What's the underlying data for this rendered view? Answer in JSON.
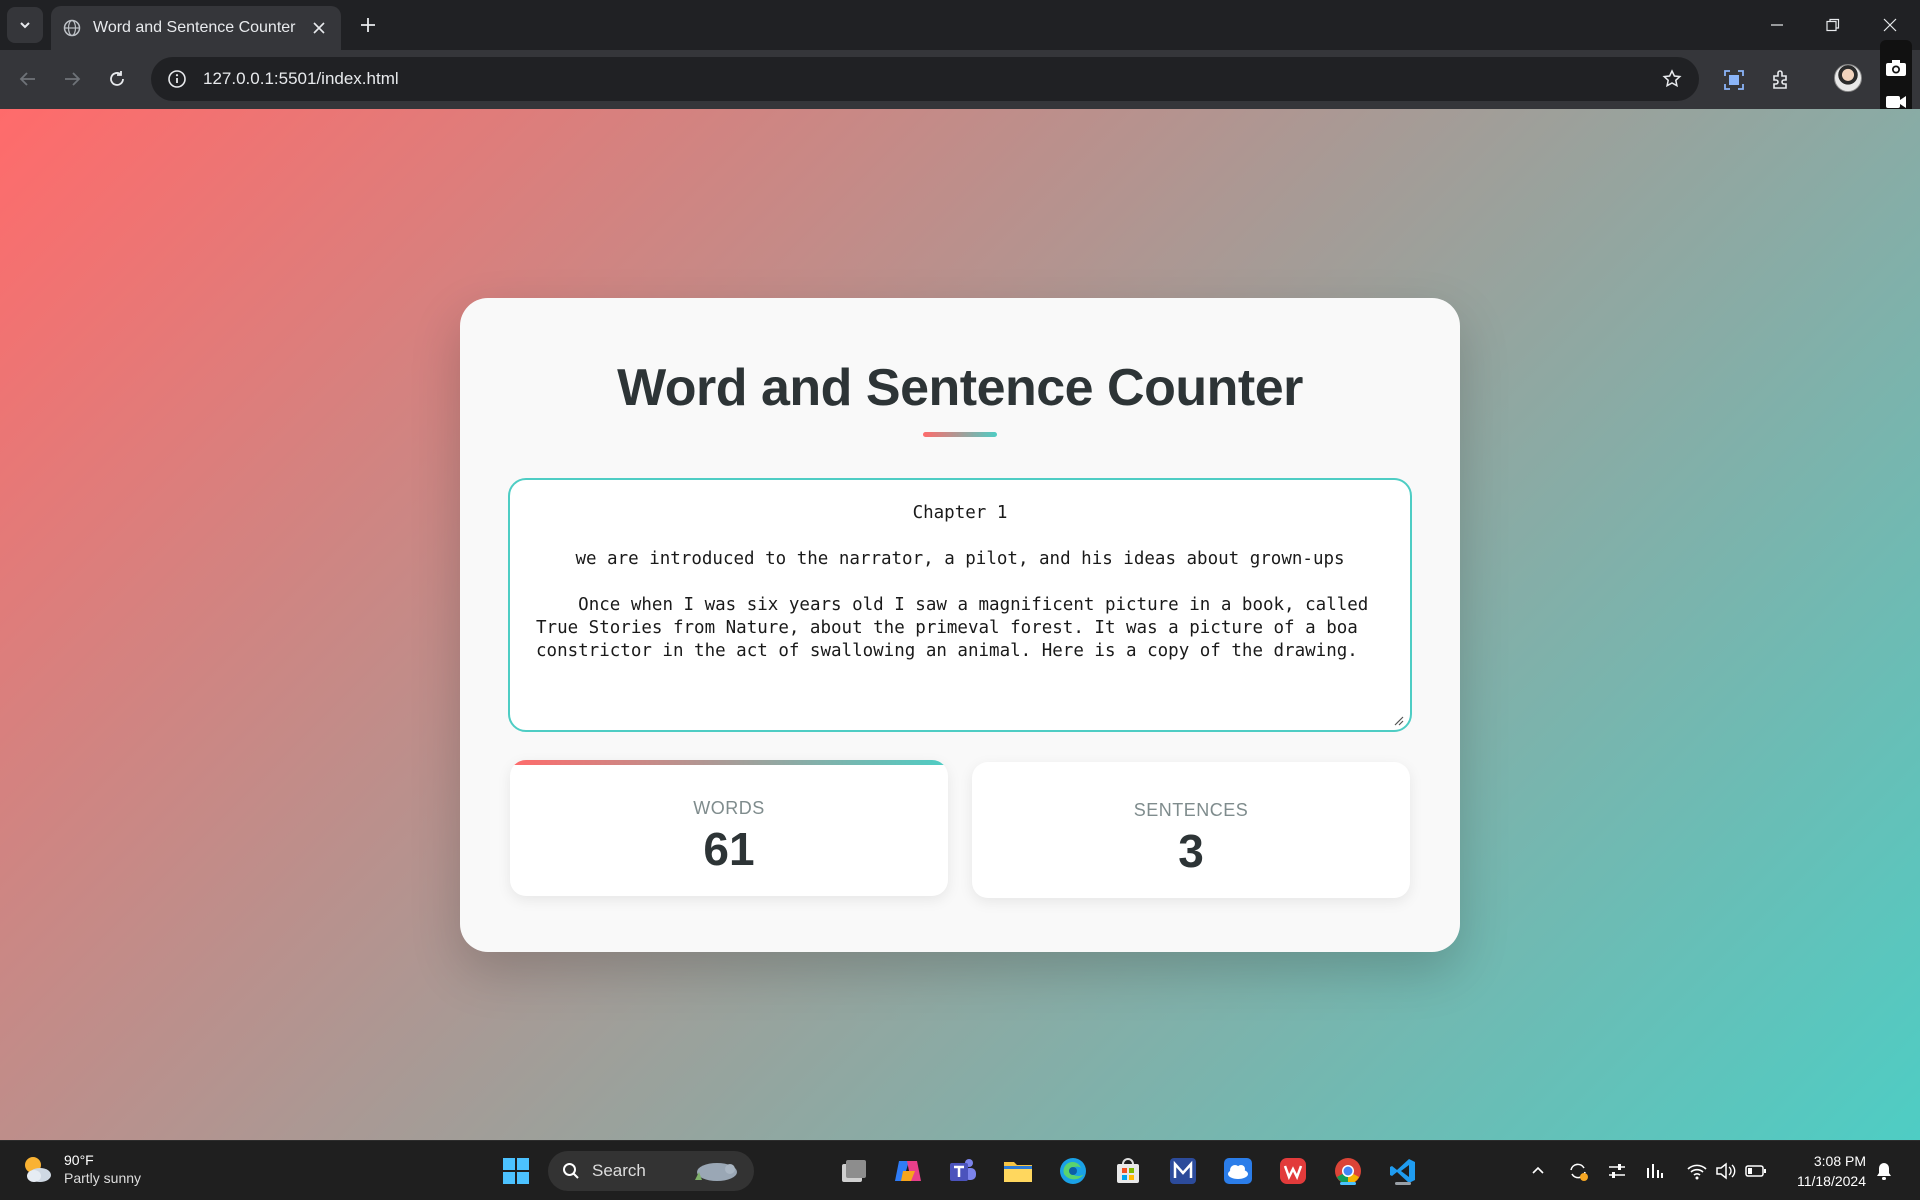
{
  "browser": {
    "tab_title": "Word and Sentence Counter",
    "url": "127.0.0.1:5501/index.html"
  },
  "page": {
    "title": "Word and Sentence Counter",
    "text_lines": {
      "heading": "Chapter 1",
      "subheading": "we are introduced to the narrator, a pilot, and his ideas about grown-ups",
      "paragraph": "    Once when I was six years old I saw a magnificent picture in a book, called True Stories from Nature, about the primeval forest. It was a picture of a boa constrictor in the act of swallowing an animal. Here is a copy of the drawing."
    },
    "stats": {
      "words_label": "WORDS",
      "words_value": "61",
      "sentences_label": "SENTENCES",
      "sentences_value": "3"
    },
    "colors": {
      "gradient_start": "#ff6b6b",
      "gradient_end": "#4ecdc4",
      "title": "#2d3436"
    }
  },
  "taskbar": {
    "weather_temp": "90°F",
    "weather_desc": "Partly sunny",
    "search_label": "Search",
    "time": "3:08 PM",
    "date": "11/18/2024"
  }
}
